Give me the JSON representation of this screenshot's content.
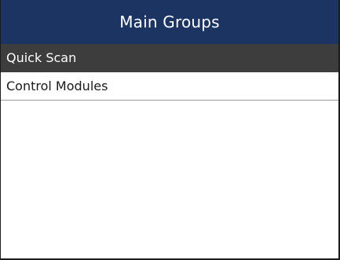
{
  "header": {
    "title": "Main Groups"
  },
  "menu": {
    "items": [
      {
        "label": "Quick Scan",
        "selected": true
      },
      {
        "label": "Control Modules",
        "selected": false
      }
    ]
  },
  "colors": {
    "header_bg": "#1c3461",
    "selected_bg": "#3d3d3d",
    "background": "#ffffff"
  }
}
